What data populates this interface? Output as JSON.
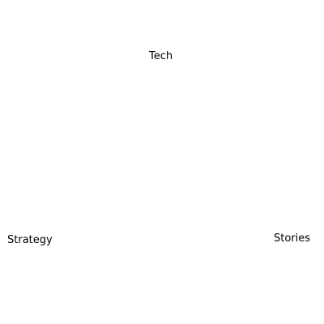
{
  "labels": {
    "top": "Tech",
    "bottom_left": "Strategy",
    "bottom_right": "Stories"
  }
}
